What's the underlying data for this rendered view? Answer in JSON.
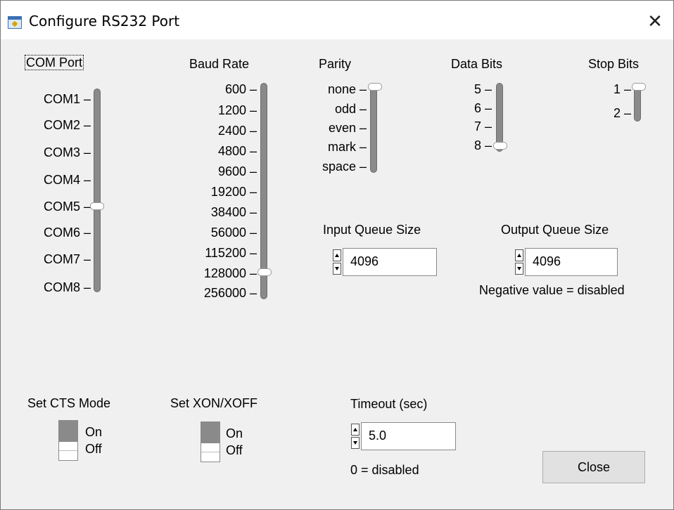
{
  "window": {
    "title": "Configure RS232 Port",
    "close_glyph": "✕",
    "icon": "app-window-icon"
  },
  "com_port": {
    "label": "COM Port",
    "options": [
      "COM1",
      "COM2",
      "COM3",
      "COM4",
      "COM5",
      "COM6",
      "COM7",
      "COM8"
    ],
    "selected": "COM5"
  },
  "baud_rate": {
    "label": "Baud Rate",
    "options": [
      "600",
      "1200",
      "2400",
      "4800",
      "9600",
      "19200",
      "38400",
      "56000",
      "115200",
      "128000",
      "256000"
    ],
    "selected": "128000"
  },
  "parity": {
    "label": "Parity",
    "options": [
      "none",
      "odd",
      "even",
      "mark",
      "space"
    ],
    "selected": "none"
  },
  "data_bits": {
    "label": "Data Bits",
    "options": [
      "5",
      "6",
      "7",
      "8"
    ],
    "selected": "8"
  },
  "stop_bits": {
    "label": "Stop Bits",
    "options": [
      "1",
      "2"
    ],
    "selected": "1"
  },
  "input_queue": {
    "label": "Input Queue Size",
    "value": "4096"
  },
  "output_queue": {
    "label": "Output Queue Size",
    "value": "4096",
    "note": "Negative value = disabled"
  },
  "cts_mode": {
    "label": "Set CTS Mode",
    "on": "On",
    "off": "Off",
    "state": "On"
  },
  "xon_xoff": {
    "label": "Set XON/XOFF",
    "on": "On",
    "off": "Off",
    "state": "On"
  },
  "timeout": {
    "label": "Timeout (sec)",
    "value": "5.0",
    "note": "0 = disabled"
  },
  "close_button": {
    "label": "Close"
  },
  "colors": {
    "track": "#8a8a8a",
    "background": "#f0f0f0",
    "titlebar": "#ffffff"
  }
}
